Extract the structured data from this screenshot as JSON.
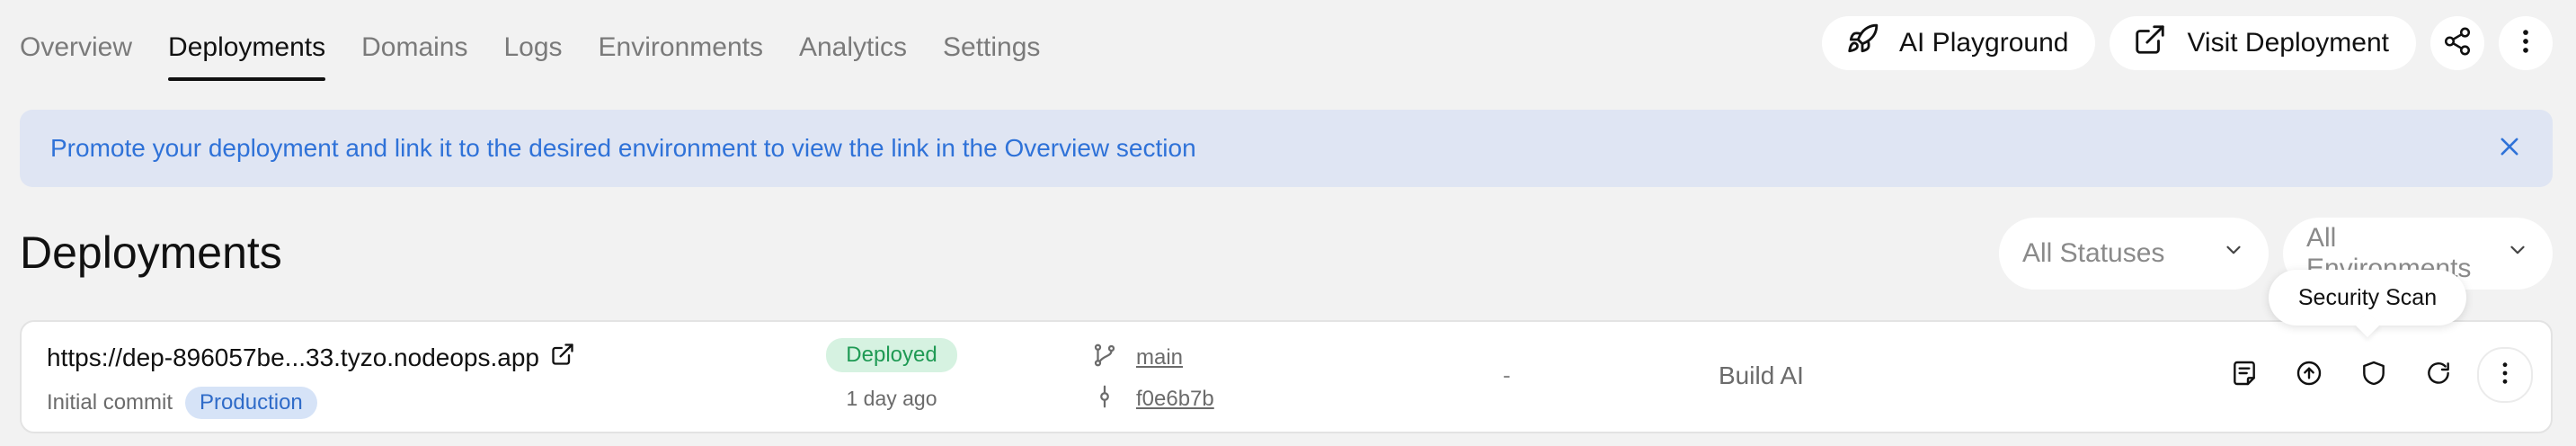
{
  "tabs": [
    {
      "label": "Overview",
      "active": false
    },
    {
      "label": "Deployments",
      "active": true
    },
    {
      "label": "Domains",
      "active": false
    },
    {
      "label": "Logs",
      "active": false
    },
    {
      "label": "Environments",
      "active": false
    },
    {
      "label": "Analytics",
      "active": false
    },
    {
      "label": "Settings",
      "active": false
    }
  ],
  "header_actions": {
    "ai_playground_label": "AI Playground",
    "visit_deployment_label": "Visit Deployment",
    "share_icon": "share-icon",
    "more_icon": "more-vertical-icon"
  },
  "banner": {
    "text": "Promote your deployment and link it to the desired environment to view the link in the Overview section",
    "color": "#2f72d8",
    "background": "#dfe5f3"
  },
  "page": {
    "title": "Deployments"
  },
  "filters": {
    "status_value": "All Statuses",
    "environment_value": "All Environments"
  },
  "deployments": [
    {
      "url": "https://dep-896057be...33.tyzo.nodeops.app",
      "commit_message": "Initial commit",
      "environment": "Production",
      "status": "Deployed",
      "status_color": "#1f9a54",
      "time_ago": "1 day ago",
      "branch": "main",
      "commit_hash": "f0e6b7b",
      "dash": "-",
      "project": "Build AI"
    }
  ],
  "tooltip": {
    "text": "Security Scan"
  },
  "colors": {
    "background": "#f2f2f2",
    "card": "#ffffff",
    "accent": "#2f72d8"
  }
}
